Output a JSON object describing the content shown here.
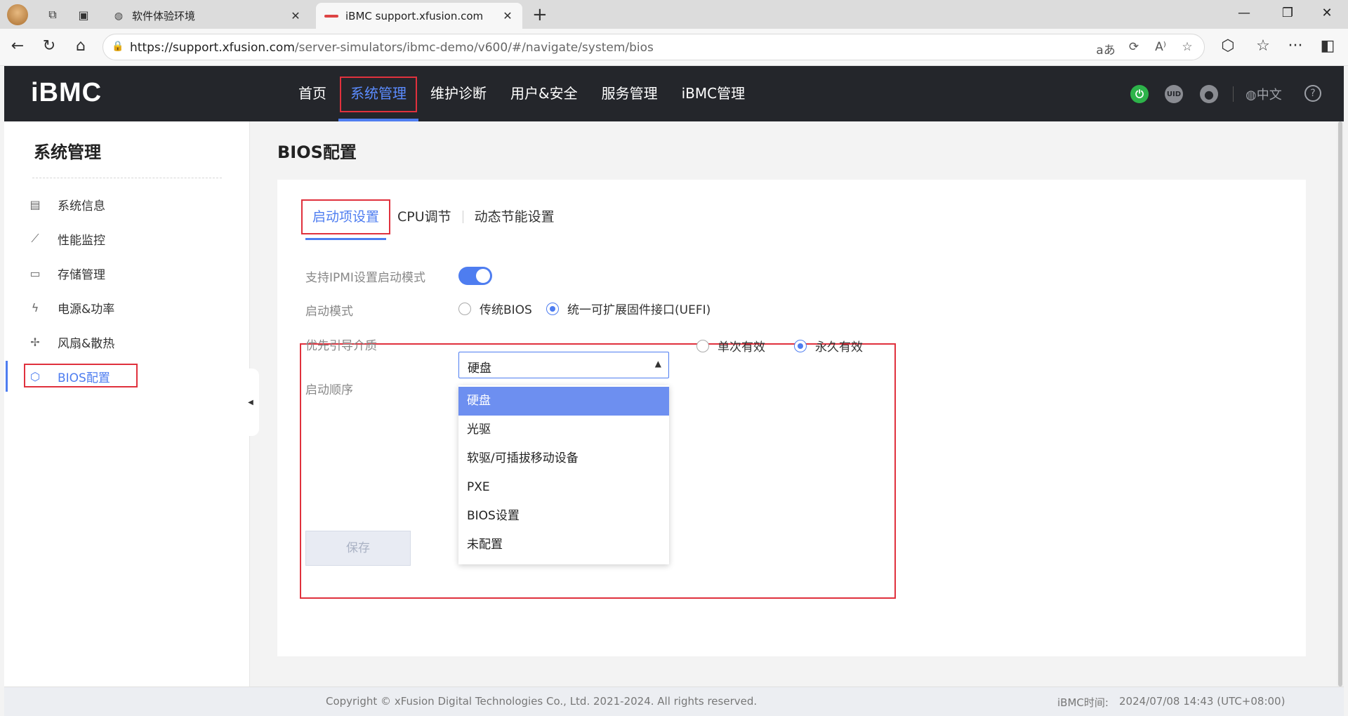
{
  "browser": {
    "tabs": [
      {
        "title": "软件体验环境",
        "active": false
      },
      {
        "title": "iBMC support.xfusion.com",
        "active": true
      }
    ],
    "url_host": "https://support.xfusion.com",
    "url_path": "/server-simulators/ibmc-demo/v600/#/navigate/system/bios",
    "icons": {
      "back": "←",
      "reload": "↻",
      "home": "⌂",
      "lock": "🔒",
      "read_aloud": "aあ",
      "refresh_page": "⟳",
      "text_size": "A⁾",
      "favorite": "☆",
      "extensions": "⬡",
      "favorites": "☆",
      "more": "···",
      "sidebar": "◧",
      "close": "✕",
      "new_tab": "+",
      "minimize": "—",
      "restore": "❐",
      "window_close": "✕"
    }
  },
  "app": {
    "logo": "iBMC",
    "nav": [
      {
        "label": "首页",
        "active": false
      },
      {
        "label": "系统管理",
        "active": true
      },
      {
        "label": "维护诊断",
        "active": false
      },
      {
        "label": "用户&安全",
        "active": false
      },
      {
        "label": "服务管理",
        "active": false
      },
      {
        "label": "iBMC管理",
        "active": false
      }
    ],
    "header_icons": {
      "power": "⏻",
      "uid": "UID",
      "user": "●",
      "globe": "◍",
      "help": "?"
    },
    "language": "中文"
  },
  "sidebar": {
    "title": "系统管理",
    "items": [
      {
        "label": "系统信息",
        "icon": "▤",
        "active": false
      },
      {
        "label": "性能监控",
        "icon": "⟋",
        "active": false
      },
      {
        "label": "存储管理",
        "icon": "▭",
        "active": false
      },
      {
        "label": "电源&功率",
        "icon": "ϟ",
        "active": false
      },
      {
        "label": "风扇&散热",
        "icon": "✢",
        "active": false
      },
      {
        "label": "BIOS配置",
        "icon": "⬡",
        "active": true
      }
    ],
    "collapse_icon": "◀"
  },
  "page": {
    "title": "BIOS配置",
    "subtabs": [
      {
        "label": "启动项设置",
        "active": true
      },
      {
        "label": "CPU调节",
        "active": false
      },
      {
        "label": "动态节能设置",
        "active": false
      }
    ],
    "ipmi_label": "支持IPMI设置启动模式",
    "ipmi_enabled": true,
    "boot_mode_label": "启动模式",
    "boot_modes": [
      {
        "label": "传统BIOS",
        "checked": false
      },
      {
        "label": "统一可扩展固件接口(UEFI)",
        "checked": true
      }
    ],
    "priority_label": "优先引导介质",
    "priority_value": "硬盘",
    "priority_options": [
      "硬盘",
      "光驱",
      "软驱/可插拔移动设备",
      "PXE",
      "BIOS设置",
      "未配置"
    ],
    "validity": [
      {
        "label": "单次有效",
        "checked": false
      },
      {
        "label": "永久有效",
        "checked": true
      }
    ],
    "boot_order_label": "启动顺序",
    "save_label": "保存",
    "caret": "▲"
  },
  "footer": {
    "copyright": "Copyright © xFusion Digital Technologies Co., Ltd. 2021-2024. All rights reserved.",
    "time_label": "iBMC时间:",
    "time_value": "2024/07/08 14:43 (UTC+08:00)"
  },
  "colors": {
    "accent": "#4e7df0",
    "highlight_box": "#e0313d",
    "header_bg": "#24262b",
    "power_green": "#2db34a"
  }
}
